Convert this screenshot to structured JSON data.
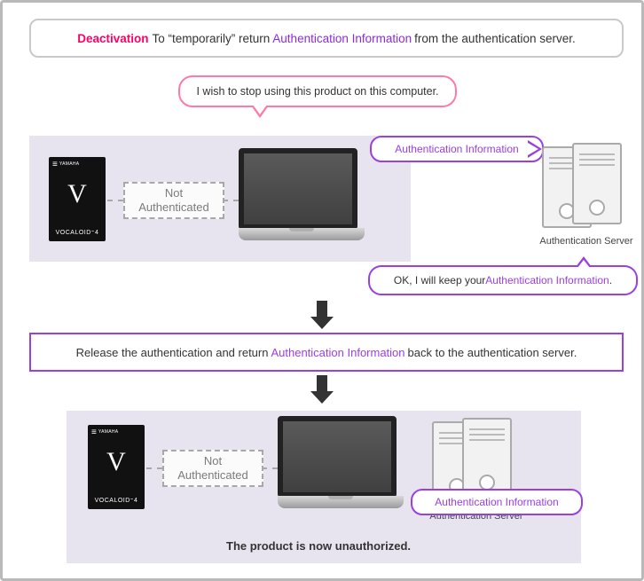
{
  "banner": {
    "lead": "Deactivation",
    "mid1": " To “temporarily” return ",
    "highlight": "Authentication Information",
    "tail": " from the authentication server."
  },
  "speech_user": "I wish to stop using this product on this computer.",
  "not_authenticated": "Not\nAuthenticated",
  "vocaloid": {
    "brand": "YAMAHA",
    "logo": "V",
    "label": "VOCALOID⁼4"
  },
  "auth_tag": "Authentication Information",
  "server_label": "Authentication Server",
  "speech_server_pre": "OK, I will keep your ",
  "speech_server_hl": "Authentication Information",
  "speech_server_post": ".",
  "midbox_pre": "Release the authentication and return ",
  "midbox_hl": "Authentication Information",
  "midbox_post": " back to the authentication server.",
  "footer": "The product is now unauthorized."
}
